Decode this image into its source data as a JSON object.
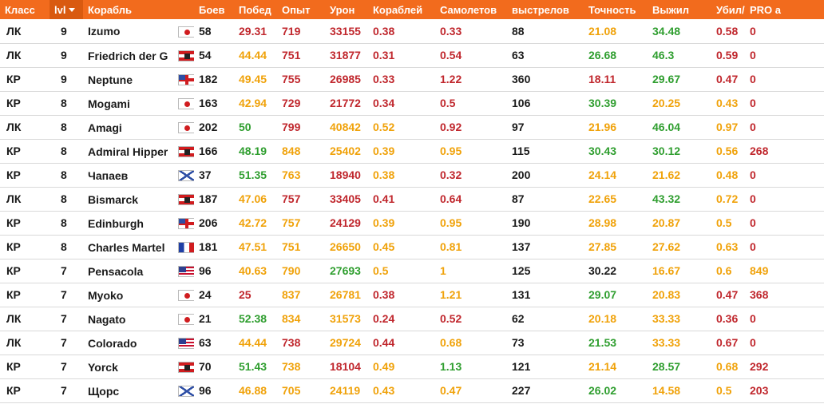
{
  "colors": {
    "header_bg": "#f26b1d",
    "red": "#c0272d",
    "orange": "#f0a20a",
    "green": "#2f9e2f"
  },
  "headers": [
    "Класс",
    "lvl",
    "Корабль",
    "Боев",
    "Побед",
    "Опыт",
    "Урон",
    "Кораблей",
    "Самолетов",
    "выстрелов",
    "Точность",
    "Выжил",
    "Убил/Убит",
    "PRO a"
  ],
  "sorted_column": "lvl",
  "rows": [
    {
      "cls": "ЛК",
      "lvl": "9",
      "ship": "Izumo",
      "flag": "jp",
      "battles": "58",
      "wins": "29.31",
      "wins_c": "red",
      "exp": "719",
      "exp_c": "red",
      "dmg": "33155",
      "dmg_c": "red",
      "ships": "0.38",
      "ships_c": "red",
      "planes": "0.33",
      "planes_c": "red",
      "shots": "88",
      "acc": "21.08",
      "acc_c": "orange",
      "surv": "34.48",
      "surv_c": "green",
      "kd": "0.58",
      "kd_c": "red",
      "pro": "0",
      "pro_c": "red"
    },
    {
      "cls": "ЛК",
      "lvl": "9",
      "ship": "Friedrich der Große",
      "flag": "de",
      "battles": "54",
      "wins": "44.44",
      "wins_c": "orange",
      "exp": "751",
      "exp_c": "red",
      "dmg": "31877",
      "dmg_c": "red",
      "ships": "0.31",
      "ships_c": "red",
      "planes": "0.54",
      "planes_c": "red",
      "shots": "63",
      "acc": "26.68",
      "acc_c": "green",
      "surv": "46.3",
      "surv_c": "green",
      "kd": "0.59",
      "kd_c": "red",
      "pro": "0",
      "pro_c": "red"
    },
    {
      "cls": "КР",
      "lvl": "9",
      "ship": "Neptune",
      "flag": "uk",
      "battles": "182",
      "wins": "49.45",
      "wins_c": "orange",
      "exp": "755",
      "exp_c": "red",
      "dmg": "26985",
      "dmg_c": "red",
      "ships": "0.33",
      "ships_c": "red",
      "planes": "1.22",
      "planes_c": "red",
      "shots": "360",
      "acc": "18.11",
      "acc_c": "red",
      "surv": "29.67",
      "surv_c": "green",
      "kd": "0.47",
      "kd_c": "red",
      "pro": "0",
      "pro_c": "red"
    },
    {
      "cls": "КР",
      "lvl": "8",
      "ship": "Mogami",
      "flag": "jp",
      "battles": "163",
      "wins": "42.94",
      "wins_c": "orange",
      "exp": "729",
      "exp_c": "red",
      "dmg": "21772",
      "dmg_c": "red",
      "ships": "0.34",
      "ships_c": "red",
      "planes": "0.5",
      "planes_c": "red",
      "shots": "106",
      "acc": "30.39",
      "acc_c": "green",
      "surv": "20.25",
      "surv_c": "orange",
      "kd": "0.43",
      "kd_c": "orange",
      "pro": "0",
      "pro_c": "red"
    },
    {
      "cls": "ЛК",
      "lvl": "8",
      "ship": "Amagi",
      "flag": "jp",
      "battles": "202",
      "wins": "50",
      "wins_c": "green",
      "exp": "799",
      "exp_c": "red",
      "dmg": "40842",
      "dmg_c": "orange",
      "ships": "0.52",
      "ships_c": "orange",
      "planes": "0.92",
      "planes_c": "red",
      "shots": "97",
      "acc": "21.96",
      "acc_c": "orange",
      "surv": "46.04",
      "surv_c": "green",
      "kd": "0.97",
      "kd_c": "orange",
      "pro": "0",
      "pro_c": "red"
    },
    {
      "cls": "КР",
      "lvl": "8",
      "ship": "Admiral Hipper",
      "flag": "de",
      "battles": "166",
      "wins": "48.19",
      "wins_c": "green",
      "exp": "848",
      "exp_c": "orange",
      "dmg": "25402",
      "dmg_c": "orange",
      "ships": "0.39",
      "ships_c": "orange",
      "planes": "0.95",
      "planes_c": "orange",
      "shots": "115",
      "acc": "30.43",
      "acc_c": "green",
      "surv": "30.12",
      "surv_c": "green",
      "kd": "0.56",
      "kd_c": "orange",
      "pro": "268",
      "pro_c": "red"
    },
    {
      "cls": "КР",
      "lvl": "8",
      "ship": "Чапаев",
      "flag": "ru",
      "battles": "37",
      "wins": "51.35",
      "wins_c": "green",
      "exp": "763",
      "exp_c": "orange",
      "dmg": "18940",
      "dmg_c": "red",
      "ships": "0.38",
      "ships_c": "orange",
      "planes": "0.32",
      "planes_c": "red",
      "shots": "200",
      "acc": "24.14",
      "acc_c": "orange",
      "surv": "21.62",
      "surv_c": "orange",
      "kd": "0.48",
      "kd_c": "orange",
      "pro": "0",
      "pro_c": "red"
    },
    {
      "cls": "ЛК",
      "lvl": "8",
      "ship": "Bismarck",
      "flag": "de",
      "battles": "187",
      "wins": "47.06",
      "wins_c": "orange",
      "exp": "757",
      "exp_c": "red",
      "dmg": "33405",
      "dmg_c": "red",
      "ships": "0.41",
      "ships_c": "red",
      "planes": "0.64",
      "planes_c": "red",
      "shots": "87",
      "acc": "22.65",
      "acc_c": "orange",
      "surv": "43.32",
      "surv_c": "green",
      "kd": "0.72",
      "kd_c": "orange",
      "pro": "0",
      "pro_c": "red"
    },
    {
      "cls": "КР",
      "lvl": "8",
      "ship": "Edinburgh",
      "flag": "uk",
      "battles": "206",
      "wins": "42.72",
      "wins_c": "orange",
      "exp": "757",
      "exp_c": "orange",
      "dmg": "24129",
      "dmg_c": "red",
      "ships": "0.39",
      "ships_c": "orange",
      "planes": "0.95",
      "planes_c": "orange",
      "shots": "190",
      "acc": "28.98",
      "acc_c": "orange",
      "surv": "20.87",
      "surv_c": "orange",
      "kd": "0.5",
      "kd_c": "orange",
      "pro": "0",
      "pro_c": "red"
    },
    {
      "cls": "КР",
      "lvl": "8",
      "ship": "Charles Martel",
      "flag": "fr",
      "battles": "181",
      "wins": "47.51",
      "wins_c": "orange",
      "exp": "751",
      "exp_c": "orange",
      "dmg": "26650",
      "dmg_c": "orange",
      "ships": "0.45",
      "ships_c": "orange",
      "planes": "0.81",
      "planes_c": "orange",
      "shots": "137",
      "acc": "27.85",
      "acc_c": "orange",
      "surv": "27.62",
      "surv_c": "orange",
      "kd": "0.63",
      "kd_c": "orange",
      "pro": "0",
      "pro_c": "red"
    },
    {
      "cls": "КР",
      "lvl": "7",
      "ship": "Pensacola",
      "flag": "us",
      "battles": "96",
      "wins": "40.63",
      "wins_c": "orange",
      "exp": "790",
      "exp_c": "orange",
      "dmg": "27693",
      "dmg_c": "green",
      "ships": "0.5",
      "ships_c": "orange",
      "planes": "1",
      "planes_c": "orange",
      "shots": "125",
      "acc": "30.22",
      "acc_c": "dark",
      "surv": "16.67",
      "surv_c": "orange",
      "kd": "0.6",
      "kd_c": "orange",
      "pro": "849",
      "pro_c": "orange"
    },
    {
      "cls": "КР",
      "lvl": "7",
      "ship": "Myoko",
      "flag": "jp",
      "battles": "24",
      "wins": "25",
      "wins_c": "red",
      "exp": "837",
      "exp_c": "orange",
      "dmg": "26781",
      "dmg_c": "orange",
      "ships": "0.38",
      "ships_c": "red",
      "planes": "1.21",
      "planes_c": "orange",
      "shots": "131",
      "acc": "29.07",
      "acc_c": "green",
      "surv": "20.83",
      "surv_c": "orange",
      "kd": "0.47",
      "kd_c": "red",
      "pro": "368",
      "pro_c": "red"
    },
    {
      "cls": "ЛК",
      "lvl": "7",
      "ship": "Nagato",
      "flag": "jp",
      "battles": "21",
      "wins": "52.38",
      "wins_c": "green",
      "exp": "834",
      "exp_c": "orange",
      "dmg": "31573",
      "dmg_c": "orange",
      "ships": "0.24",
      "ships_c": "red",
      "planes": "0.52",
      "planes_c": "red",
      "shots": "62",
      "acc": "20.18",
      "acc_c": "orange",
      "surv": "33.33",
      "surv_c": "orange",
      "kd": "0.36",
      "kd_c": "red",
      "pro": "0",
      "pro_c": "red"
    },
    {
      "cls": "ЛК",
      "lvl": "7",
      "ship": "Colorado",
      "flag": "us",
      "battles": "63",
      "wins": "44.44",
      "wins_c": "orange",
      "exp": "738",
      "exp_c": "red",
      "dmg": "29724",
      "dmg_c": "orange",
      "ships": "0.44",
      "ships_c": "red",
      "planes": "0.68",
      "planes_c": "orange",
      "shots": "73",
      "acc": "21.53",
      "acc_c": "green",
      "surv": "33.33",
      "surv_c": "orange",
      "kd": "0.67",
      "kd_c": "red",
      "pro": "0",
      "pro_c": "red"
    },
    {
      "cls": "КР",
      "lvl": "7",
      "ship": "Yorck",
      "flag": "de",
      "battles": "70",
      "wins": "51.43",
      "wins_c": "green",
      "exp": "738",
      "exp_c": "orange",
      "dmg": "18104",
      "dmg_c": "red",
      "ships": "0.49",
      "ships_c": "orange",
      "planes": "1.13",
      "planes_c": "green",
      "shots": "121",
      "acc": "21.14",
      "acc_c": "orange",
      "surv": "28.57",
      "surv_c": "green",
      "kd": "0.68",
      "kd_c": "orange",
      "pro": "292",
      "pro_c": "red"
    },
    {
      "cls": "КР",
      "lvl": "7",
      "ship": "Щорс",
      "flag": "ru",
      "battles": "96",
      "wins": "46.88",
      "wins_c": "orange",
      "exp": "705",
      "exp_c": "orange",
      "dmg": "24119",
      "dmg_c": "orange",
      "ships": "0.43",
      "ships_c": "orange",
      "planes": "0.47",
      "planes_c": "orange",
      "shots": "227",
      "acc": "26.02",
      "acc_c": "green",
      "surv": "14.58",
      "surv_c": "orange",
      "kd": "0.5",
      "kd_c": "orange",
      "pro": "203",
      "pro_c": "red"
    }
  ]
}
